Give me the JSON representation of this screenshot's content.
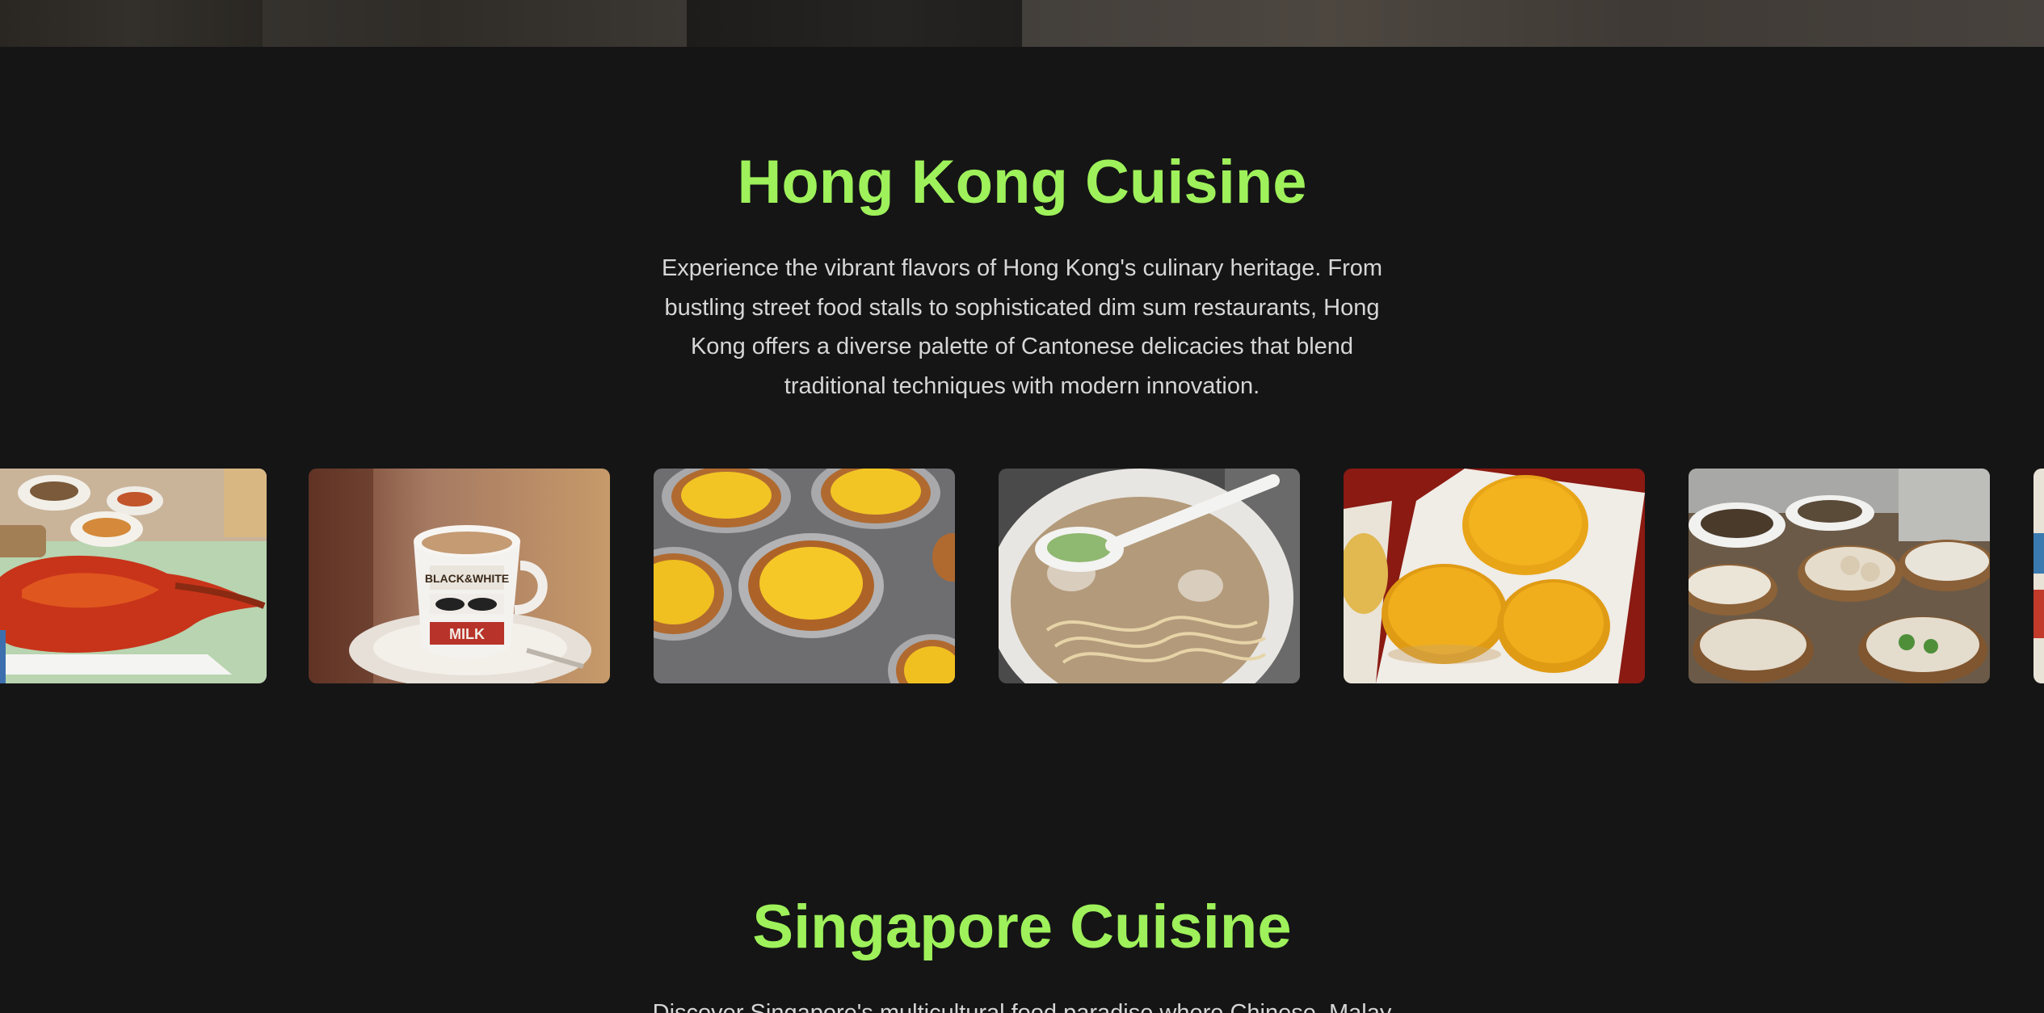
{
  "top_strip": {
    "label": "top-banner-images"
  },
  "hong_kong": {
    "title": "Hong Kong Cuisine",
    "description": "Experience the vibrant flavors of Hong Kong's culinary heritage. From bustling street food stalls to sophisticated dim sum restaurants, Hong Kong offers a diverse palette of Cantonese delicacies that blend traditional techniques with modern innovation.",
    "gallery": [
      {
        "name": "roast-goose-image"
      },
      {
        "name": "milk-tea-image",
        "cup_text_1": "BLACK&WHITE",
        "cup_text_2": "MILK"
      },
      {
        "name": "egg-tarts-image"
      },
      {
        "name": "wonton-noodles-image"
      },
      {
        "name": "pineapple-buns-image"
      },
      {
        "name": "dim-sum-image"
      },
      {
        "name": "partial-next-image"
      }
    ]
  },
  "singapore": {
    "title": "Singapore Cuisine",
    "description": "Discover Singapore's multicultural food paradise where Chinese, Malay"
  },
  "colors": {
    "background": "#151515",
    "accent_green": "#9ef15a",
    "body_text": "#d6d6d6"
  }
}
